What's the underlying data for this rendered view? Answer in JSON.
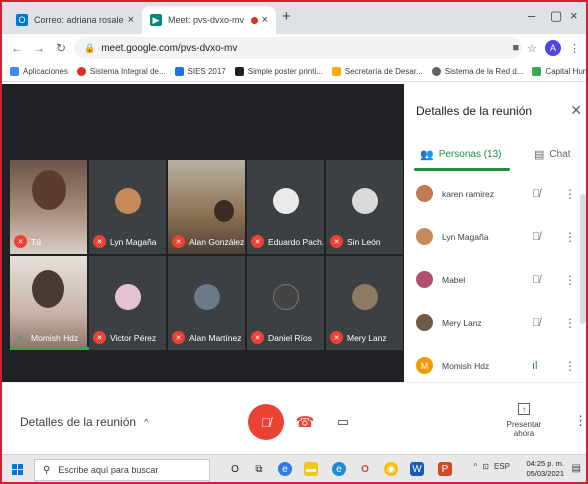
{
  "browser": {
    "tabs": [
      {
        "title": "Correo: adriana rosales - Outlook",
        "active": false
      },
      {
        "title": "Meet: pvs-dvxo-mv",
        "active": true
      }
    ],
    "url": "meet.google.com/pvs-dvxo-mv",
    "profile_initial": "A",
    "bookmarks": [
      {
        "label": "Aplicaciones",
        "color": "#4285f4"
      },
      {
        "label": "Sistema Integral de...",
        "color": "#d93025"
      },
      {
        "label": "SIES 2017",
        "color": "#1a73e8"
      },
      {
        "label": "Simple poster printi...",
        "color": "#202124"
      },
      {
        "label": "Secretaría de Desar...",
        "color": "#f9ab00"
      },
      {
        "label": "Sistema de la Red d...",
        "color": "#5f6368"
      },
      {
        "label": "Capital Humano - S...",
        "color": "#34a853"
      }
    ]
  },
  "meet": {
    "participants": [
      {
        "name": "Tú",
        "muted": true,
        "color": "#7a5a4a"
      },
      {
        "name": "Lyn Magaña",
        "muted": true,
        "color": "#c58a5a"
      },
      {
        "name": "Alan González",
        "muted": true,
        "color": "#8a6f52"
      },
      {
        "name": "Eduardo Pach...",
        "muted": true,
        "color": "#eaeaea"
      },
      {
        "name": "Sin León",
        "muted": true,
        "color": "#d9d9d9"
      },
      {
        "name": "Momish Hdz",
        "muted": false,
        "color": "#b8a095"
      },
      {
        "name": "Victor Pérez",
        "muted": true,
        "color": "#e5c3d0"
      },
      {
        "name": "Alan Martínez",
        "muted": true,
        "color": "#6b7a86"
      },
      {
        "name": "Daniel Ríos",
        "muted": true,
        "color": "#444444"
      },
      {
        "name": "Mery Lanz",
        "muted": true,
        "color": "#8c7a63"
      }
    ]
  },
  "panel": {
    "title": "Detalles de la reunión",
    "tab_people": "Personas (13)",
    "tab_chat": "Chat",
    "people": [
      {
        "name": "karen ramirez",
        "muted": true,
        "color": "#c07a55"
      },
      {
        "name": "Lyn Magaña",
        "muted": true,
        "color": "#c58a5a"
      },
      {
        "name": "Mabel",
        "muted": true,
        "color": "#b0506e"
      },
      {
        "name": "Mery Lanz",
        "muted": true,
        "color": "#6d5a48"
      },
      {
        "name": "Momish Hdz",
        "muted": false,
        "color": "#f29900",
        "initial": "M"
      }
    ]
  },
  "bottombar": {
    "meeting_details": "Detalles de la reunión",
    "present_label": "Presentar ahora"
  },
  "taskbar": {
    "search_placeholder": "Escribe aquí para buscar",
    "language": "ESP",
    "time": "04:25 p. m.",
    "date": "05/03/2021"
  }
}
